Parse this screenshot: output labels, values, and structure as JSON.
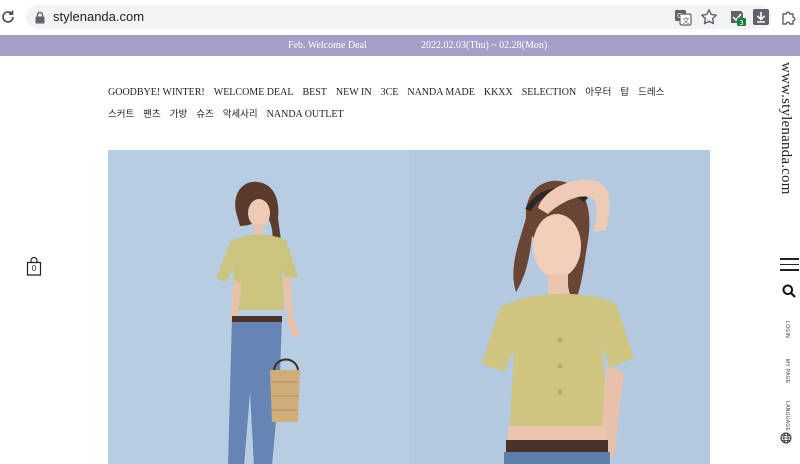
{
  "browser": {
    "url": "stylenanda.com",
    "icons": [
      "reload-icon",
      "lock-icon",
      "translate-icon",
      "star-icon",
      "extension-badge-icon",
      "download-icon",
      "puzzle-icon"
    ],
    "badge_count": "3"
  },
  "promo": {
    "title": "Feb. Welcome Deal",
    "dates": "2022.02.03(Thu) ~ 02.28(Mon)",
    "background": "#a39fc8"
  },
  "nav": {
    "items": [
      {
        "label": "GOODBYE! WINTER!",
        "kr": false
      },
      {
        "label": "WELCOME DEAL",
        "kr": false
      },
      {
        "label": "BEST",
        "kr": false
      },
      {
        "label": "NEW IN",
        "kr": false
      },
      {
        "label": "3CE",
        "kr": false
      },
      {
        "label": "NANDA MADE",
        "kr": false
      },
      {
        "label": "KKXX",
        "kr": false
      },
      {
        "label": "SELECTION",
        "kr": false
      },
      {
        "label": "아우터",
        "kr": true
      },
      {
        "label": "탑",
        "kr": true
      },
      {
        "label": "드레스",
        "kr": true
      },
      {
        "label": "스커트",
        "kr": true
      },
      {
        "label": "팬츠",
        "kr": true
      },
      {
        "label": "가방",
        "kr": true
      },
      {
        "label": "슈즈",
        "kr": true
      },
      {
        "label": "악세사리",
        "kr": true
      },
      {
        "label": "NANDA OUTLET",
        "kr": false
      }
    ]
  },
  "cart": {
    "count": "0"
  },
  "sidebar": {
    "logo": "www.stylenanda.com",
    "login": "LOGIN",
    "mypage": "MY PAGE",
    "language": "LANGUAGE"
  },
  "colors": {
    "hero_bg": "#b5cbe0",
    "top": "#cbc37d",
    "jeans": "#5e7fae"
  }
}
